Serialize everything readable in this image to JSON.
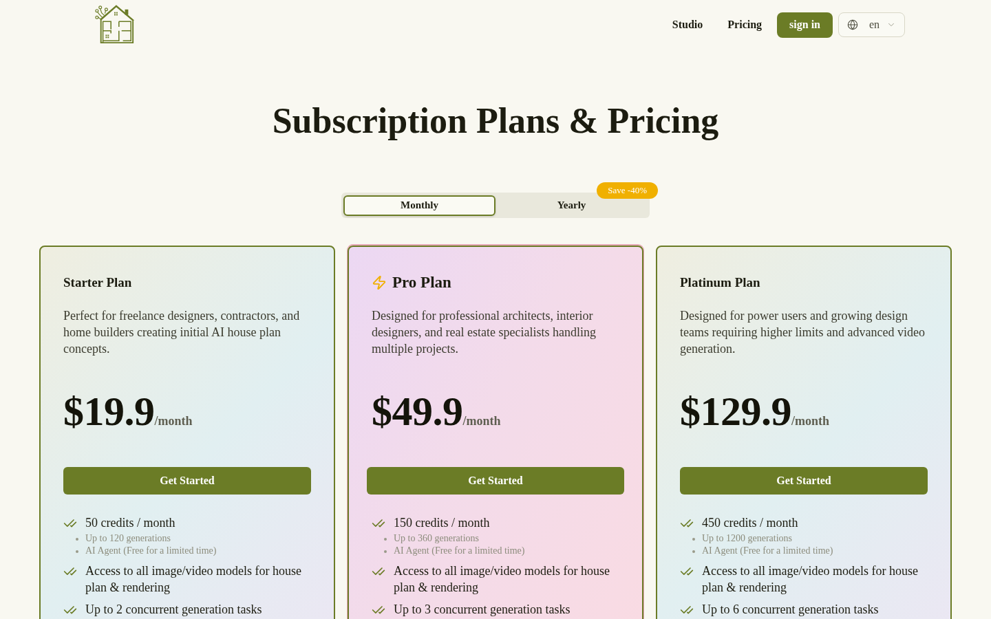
{
  "header": {
    "nav": [
      {
        "label": "Studio"
      },
      {
        "label": "Pricing"
      }
    ],
    "sign_in": "sign in",
    "language": {
      "value": "en"
    }
  },
  "title": "Subscription Plans & Pricing",
  "billing_toggle": {
    "options": [
      {
        "label": "Monthly",
        "selected": true
      },
      {
        "label": "Yearly",
        "selected": false
      }
    ],
    "badge": "Save -40%"
  },
  "plans": [
    {
      "kind": "standard",
      "name": "Starter Plan",
      "description": "Perfect for freelance designers, contractors, and home builders creating initial AI house plan concepts.",
      "price": "$19.9",
      "period": "/month",
      "button": "Get Started",
      "features": [
        {
          "text": "50 credits / month",
          "details": [
            "Up to 120 generations",
            "AI Agent (Free for a limited time)"
          ]
        },
        {
          "text": "Access to all image/video models for house plan & rendering"
        },
        {
          "text": "Up to 2 concurrent generation tasks"
        }
      ]
    },
    {
      "kind": "featured",
      "name": "Pro Plan",
      "description": "Designed for professional architects, interior designers, and real estate specialists handling multiple projects.",
      "price": "$49.9",
      "period": "/month",
      "button": "Get Started",
      "features": [
        {
          "text": "150 credits / month",
          "details": [
            "Up to 360 generations",
            "AI Agent (Free for a limited time)"
          ]
        },
        {
          "text": "Access to all image/video models for house plan & rendering"
        },
        {
          "text": "Up to 3 concurrent generation tasks"
        }
      ]
    },
    {
      "kind": "standard",
      "name": "Platinum Plan",
      "description": "Designed for power users and growing design teams requiring higher limits and advanced video generation.",
      "price": "$129.9",
      "period": "/month",
      "button": "Get Started",
      "features": [
        {
          "text": "450 credits / month",
          "details": [
            "Up to 1200 generations",
            "AI Agent (Free for a limited time)"
          ]
        },
        {
          "text": "Access to all image/video models for house plan & rendering"
        },
        {
          "text": "Up to 6 concurrent generation tasks"
        }
      ]
    }
  ]
}
